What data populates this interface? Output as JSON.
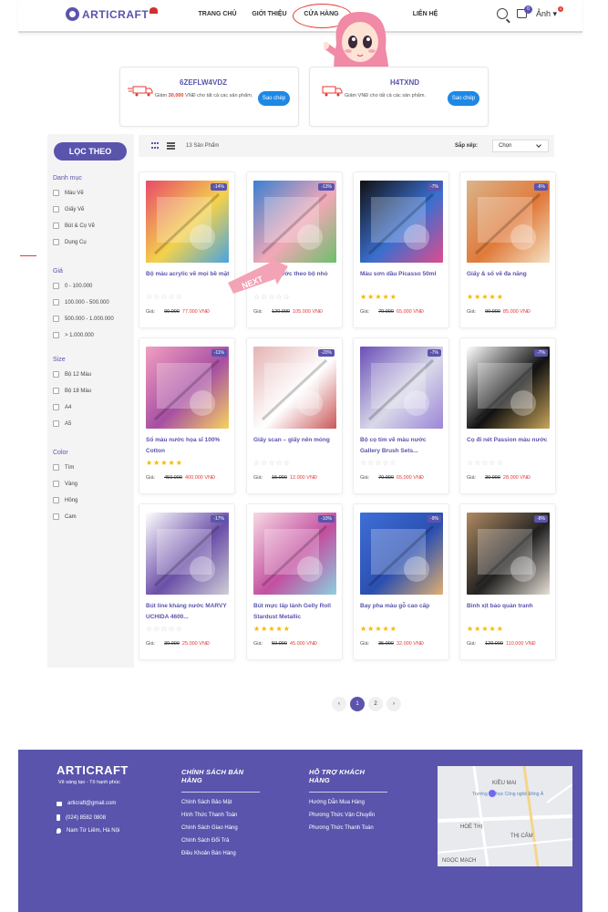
{
  "header": {
    "logo": "ARTICRAFT",
    "nav": [
      "TRANG CHỦ",
      "GIỚI THIỆU",
      "CỬA HÀNG",
      "",
      "LIÊN HỆ"
    ],
    "cart_count": "0",
    "avatar_alt": "Ảnh",
    "notif_count": "0"
  },
  "coupons": [
    {
      "code": "6ZEFLW4VDZ",
      "desc_prefix": "Giảm ",
      "amount": "30.000",
      "desc_suffix": " VNĐ cho tất cả các sản phẩm.",
      "button": "Sao chép"
    },
    {
      "code": "H4TXND",
      "desc_prefix": "Giảm ",
      "amount": "",
      "desc_suffix": " VNĐ cho tất cả các sản phẩm.",
      "button": "Sao chép"
    }
  ],
  "sidebar": {
    "filter_button": "LỌC THEO",
    "sections": [
      {
        "title": "Danh mục",
        "items": [
          "Màu Vẽ",
          "Giấy Vẽ",
          "Bút & Cọ Vẽ",
          "Dụng Cụ"
        ]
      },
      {
        "title": "Giá",
        "items": [
          "0 - 100.000",
          "100.000 - 500.000",
          "500.000 - 1.000.000",
          "> 1.000.000"
        ]
      },
      {
        "title": "Size",
        "items": [
          "Bộ 12 Màu",
          "Bộ 18 Màu",
          "A4",
          "A5"
        ]
      },
      {
        "title": "Color",
        "items": [
          "Tím",
          "Vàng",
          "Hồng",
          "Cam"
        ]
      }
    ]
  },
  "toolbar": {
    "count": "13 Sản Phẩm",
    "sort_label": "Sắp xếp:",
    "sort_value": "Chọn"
  },
  "products": [
    {
      "name": "Bộ màu acrylic vẽ mọi bề mặt",
      "discount": "-14%",
      "old": "90.000",
      "new": "77.000 VNĐ",
      "rated": false,
      "colors": [
        "#e84a6b",
        "#f3d24b",
        "#4aa4e0"
      ]
    },
    {
      "name": "Bộ màu nước theo bộ nhỏ",
      "discount": "-13%",
      "old": "120.000",
      "new": "105.000 VNĐ",
      "rated": false,
      "colors": [
        "#3b7fd1",
        "#f2a8b7",
        "#6cbf6a"
      ]
    },
    {
      "name": "Màu sơn dầu Picasso 50ml",
      "discount": "-7%",
      "old": "70.000",
      "new": "65.000 VNĐ",
      "rated": true,
      "colors": [
        "#111111",
        "#3a6fcf",
        "#e04b8c"
      ]
    },
    {
      "name": "Giấy & sổ vẽ đa năng",
      "discount": "-6%",
      "old": "90.000",
      "new": "85.000 VNĐ",
      "rated": true,
      "colors": [
        "#d9b48a",
        "#e07a3a",
        "#f4e2c4"
      ]
    },
    {
      "name": "Sổ màu nước họa sĩ 100% Cotton",
      "discount": "-11%",
      "old": "450.000",
      "new": "400.000 VNĐ",
      "rated": true,
      "colors": [
        "#f29fc0",
        "#a64fa3",
        "#f7d35e"
      ]
    },
    {
      "name": "Giấy scan – giấy nến mỏng",
      "discount": "-20%",
      "old": "15.000",
      "new": "12.000 VNĐ",
      "rated": false,
      "colors": [
        "#e5b3b3",
        "#ffffff",
        "#c9585a"
      ]
    },
    {
      "name": "Bộ cọ tím vẽ màu nước Gallery Brush Sets...",
      "discount": "-7%",
      "old": "70.000",
      "new": "65.000 VNĐ",
      "rated": false,
      "colors": [
        "#6a4fb7",
        "#d8d8e8",
        "#9b86d8"
      ]
    },
    {
      "name": "Cọ đi nét Passion màu nước",
      "discount": "-7%",
      "old": "30.000",
      "new": "28.000 VNĐ",
      "rated": false,
      "colors": [
        "#ffffff",
        "#111111",
        "#c9a65a"
      ]
    },
    {
      "name": "Bút line kháng nước MARVY UCHIDA 4600...",
      "discount": "-17%",
      "old": "30.000",
      "new": "25.000 VNĐ",
      "rated": false,
      "colors": [
        "#ffffff",
        "#6b4fa8",
        "#cfcfd6"
      ]
    },
    {
      "name": "Bút mực lấp lánh Gelly Roll Stardust Metallic",
      "discount": "-10%",
      "old": "50.000",
      "new": "45.000 VNĐ",
      "rated": true,
      "colors": [
        "#f7d9e4",
        "#c34fa0",
        "#8ad0e0"
      ]
    },
    {
      "name": "Bay pha màu gỗ cao cấp",
      "discount": "-9%",
      "old": "35.000",
      "new": "32.000 VNĐ",
      "rated": true,
      "colors": [
        "#3f6fd8",
        "#2b4fb0",
        "#e0b070"
      ]
    },
    {
      "name": "Bình xịt bảo quản tranh",
      "discount": "-8%",
      "old": "120.000",
      "new": "110.000 VNĐ",
      "rated": true,
      "colors": [
        "#b08a62",
        "#222222",
        "#e8e0d6"
      ]
    }
  ],
  "price_label": "Giá:",
  "pagination": [
    "‹",
    "1",
    "2",
    "›"
  ],
  "footer": {
    "logo": "ARTICRAFT",
    "slogan": "Vẽ sáng tạo - Tô hạnh phúc",
    "email": "articraft@gmail.com",
    "phone": "(024) 8582 0808",
    "address": "Nam Từ Liêm, Hà Nội",
    "col1_title": "CHÍNH SÁCH BÁN HÀNG",
    "col1_items": [
      "Chính Sách Bảo Mật",
      "Hình Thức Thanh Toán",
      "Chính Sách Giao Hàng",
      "Chính Sách Đổi Trả",
      "Điều Khoản Bán Hàng"
    ],
    "col2_title": "HỖ TRỢ KHÁCH HÀNG",
    "col2_items": [
      "Hướng Dẫn Mua Hàng",
      "Phương Thức Vận Chuyển",
      "Phương Thức Thanh Toán"
    ],
    "map_labels": [
      "KIỀU MAI",
      "Trường đại học Công nghệ Đông Á",
      "HOÈ THỊ",
      "THỊ CẤM",
      "NGỌC MẠCH"
    ]
  },
  "overlay": {
    "next_label": "NEXT"
  },
  "colors": {
    "brand": "#5a54ad",
    "price": "#e53935",
    "copy_button": "#1e88e5",
    "star": "#f5b800"
  }
}
